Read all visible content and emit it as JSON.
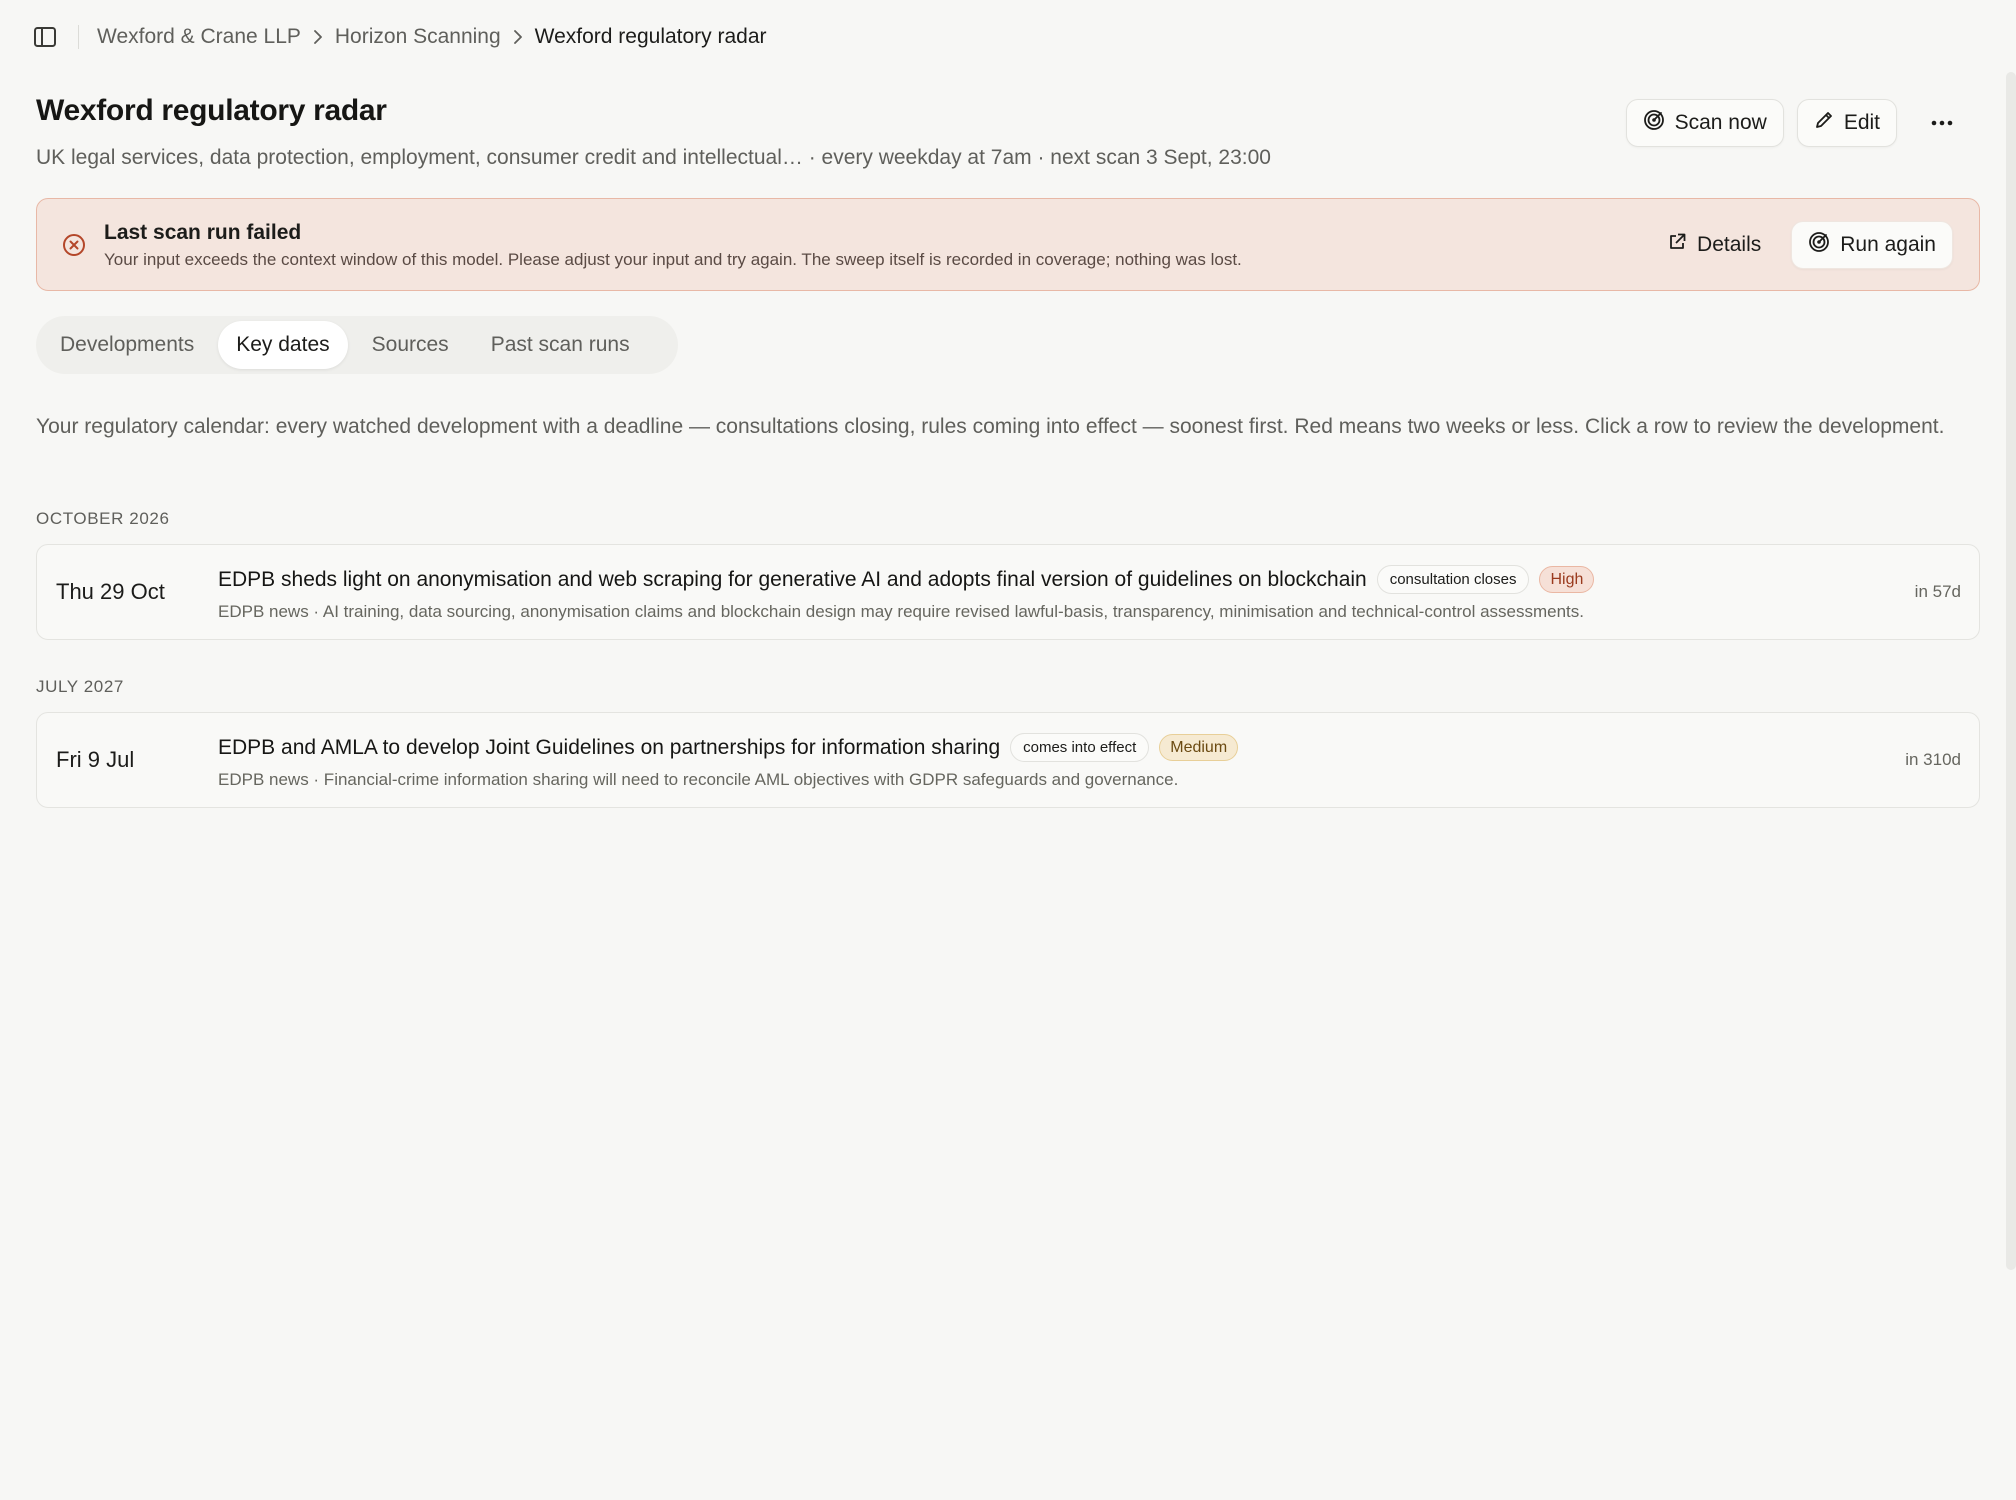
{
  "breadcrumb": {
    "items": [
      "Wexford & Crane LLP",
      "Horizon Scanning",
      "Wexford regulatory radar"
    ]
  },
  "header": {
    "title": "Wexford regulatory radar",
    "subtitle": "UK legal services, data protection, employment, consumer credit and intellectual… · every weekday at 7am · next scan 3 Sept, 23:00",
    "scan_now_label": "Scan now",
    "edit_label": "Edit"
  },
  "banner": {
    "title": "Last scan run failed",
    "description": "Your input exceeds the context window of this model. Please adjust your input and try again. The sweep itself is recorded in coverage; nothing was lost.",
    "details_label": "Details",
    "run_again_label": "Run again"
  },
  "tabs": [
    {
      "label": "Developments",
      "active": false
    },
    {
      "label": "Key dates",
      "active": true
    },
    {
      "label": "Sources",
      "active": false
    },
    {
      "label": "Past scan runs",
      "active": false
    }
  ],
  "intro": "Your regulatory calendar: every watched development with a deadline — consultations closing, rules coming into effect — soonest first. Red means two weeks or less. Click a row to review the development.",
  "groups": [
    {
      "label": "OCTOBER 2026",
      "rows": [
        {
          "date": "Thu 29 Oct",
          "title": "EDPB sheds light on anonymisation and web scraping for generative AI and adopts final version of guidelines on blockchain",
          "type": "consultation closes",
          "priority": "High",
          "description": "EDPB news · AI training, data sourcing, anonymisation claims and blockchain design may require revised lawful-basis, transparency, minimisation and technical-control assessments.",
          "due": "in 57d"
        }
      ]
    },
    {
      "label": "JULY 2027",
      "rows": [
        {
          "date": "Fri 9 Jul",
          "title": "EDPB and AMLA to develop Joint Guidelines on partnerships for information sharing",
          "type": "comes into effect",
          "priority": "Medium",
          "description": "EDPB news · Financial-crime information sharing will need to reconcile AML objectives with GDPR safeguards and governance.",
          "due": "in 310d"
        }
      ]
    }
  ],
  "colors": {
    "background": "#f7f7f5",
    "error_banner": "#f4e5de",
    "error_accent": "#b4472a",
    "high_badge": "#f6e0d7",
    "medium_badge": "#f6ead2"
  },
  "icons": {
    "sidebar_toggle": "sidebar-panel-icon",
    "breadcrumb_separator": "chevron-right-icon",
    "scan": "radar-icon",
    "edit": "pencil-icon",
    "more": "more-horizontal-icon",
    "error": "x-circle-icon",
    "details": "external-link-icon"
  }
}
